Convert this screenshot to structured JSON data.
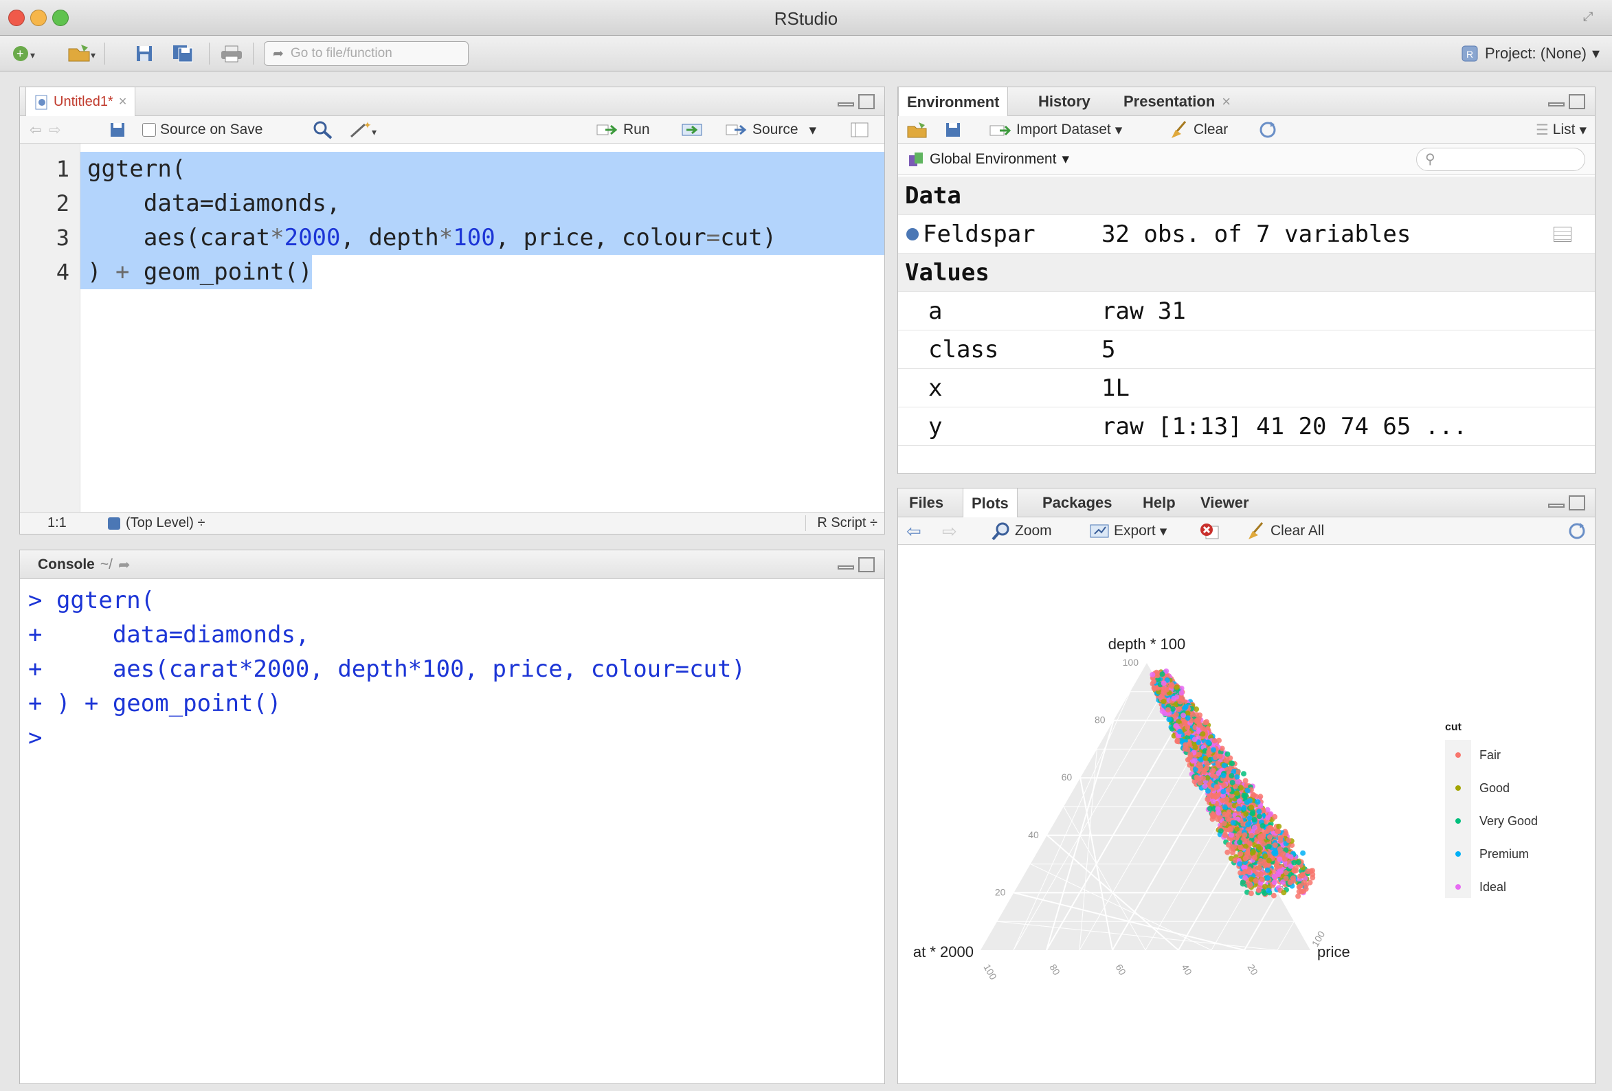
{
  "window": {
    "title": "RStudio",
    "traffic_colors": [
      "#f05a4a",
      "#f6b64a",
      "#5fc24e"
    ]
  },
  "toolbar": {
    "goto_placeholder": "Go to file/function",
    "project_label": "Project: (None)",
    "project_caret": "▾"
  },
  "editor": {
    "tab_label": "Untitled1*",
    "tab_close": "×",
    "source_on_save": "Source on Save",
    "run_label": "Run",
    "source_label": "Source",
    "line_numbers": [
      "1",
      "2",
      "3",
      "4"
    ],
    "lines": [
      [
        {
          "t": "ggtern(",
          "c": "plain"
        }
      ],
      [
        {
          "t": "    data=diamonds,",
          "c": "plain"
        }
      ],
      [
        {
          "t": "    aes(carat",
          "c": "plain"
        },
        {
          "t": "*",
          "c": "op"
        },
        {
          "t": "2000",
          "c": "num"
        },
        {
          "t": ", depth",
          "c": "plain"
        },
        {
          "t": "*",
          "c": "op"
        },
        {
          "t": "100",
          "c": "num"
        },
        {
          "t": ", price, colour",
          "c": "plain"
        },
        {
          "t": "=",
          "c": "op"
        },
        {
          "t": "cut)",
          "c": "plain"
        }
      ],
      [
        {
          "t": ")",
          "c": "plain"
        },
        {
          "t": " + ",
          "c": "op"
        },
        {
          "t": "geom_point()",
          "c": "plain"
        }
      ]
    ],
    "status_pos": "1:1",
    "status_scope": "(Top Level) ÷",
    "status_type": "R Script ÷"
  },
  "console": {
    "title": "Console",
    "path": "~/",
    "lines": [
      "> ggtern(",
      "+     data=diamonds,",
      "+     aes(carat*2000, depth*100, price, colour=cut)",
      "+ ) + geom_point()",
      ">"
    ]
  },
  "environment": {
    "tabs": [
      "Environment",
      "History",
      "Presentation"
    ],
    "presentation_close": "×",
    "import_label": "Import Dataset",
    "clear_label": "Clear",
    "list_label": "List",
    "scope_label": "Global Environment",
    "data_header": "Data",
    "data_rows": [
      {
        "name": "Feldspar",
        "value": "32 obs. of 7 variables"
      }
    ],
    "values_header": "Values",
    "value_rows": [
      {
        "name": "a",
        "value": "raw 31"
      },
      {
        "name": "class",
        "value": "5"
      },
      {
        "name": "x",
        "value": "1L"
      },
      {
        "name": "y",
        "value": "raw [1:13] 41 20 74 65 ..."
      }
    ]
  },
  "files": {
    "tabs": [
      "Files",
      "Plots",
      "Packages",
      "Help",
      "Viewer"
    ],
    "zoom_label": "Zoom",
    "export_label": "Export",
    "clear_all_label": "Clear All"
  },
  "chart_data": {
    "type": "scatter",
    "subtype": "ternary",
    "top_label": "depth * 100",
    "left_label": "at * 2000",
    "right_label": "price",
    "ticks": [
      "20",
      "40",
      "60",
      "80",
      "100"
    ],
    "legend_title": "cut",
    "legend_position": "right",
    "series": [
      {
        "name": "Fair",
        "color": "#f8766d"
      },
      {
        "name": "Good",
        "color": "#a3a500"
      },
      {
        "name": "Very Good",
        "color": "#00bf7d"
      },
      {
        "name": "Premium",
        "color": "#00b0f6"
      },
      {
        "name": "Ideal",
        "color": "#e76bf3"
      }
    ]
  }
}
